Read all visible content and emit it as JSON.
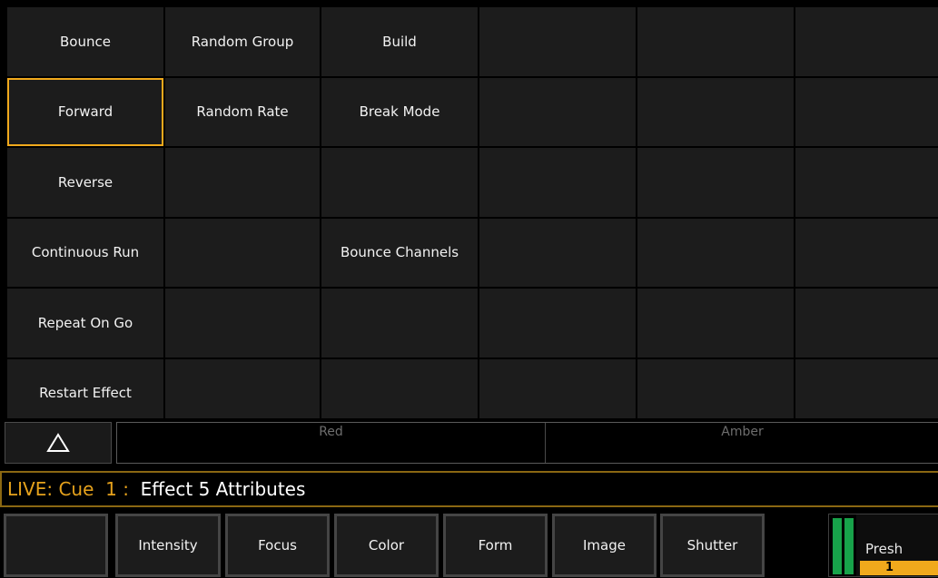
{
  "grid_cells": [
    "Bounce",
    "Random Group",
    "Build",
    "",
    "",
    "",
    "Forward",
    "Random Rate",
    "Break Mode",
    "",
    "",
    "",
    "Reverse",
    "",
    "",
    "",
    "",
    "",
    "Continuous Run",
    "",
    "Bounce Channels",
    "",
    "",
    "",
    "Repeat On Go",
    "",
    "",
    "",
    "",
    "",
    "Restart Effect",
    "",
    "",
    "",
    "",
    ""
  ],
  "selected_cell": "Forward",
  "encoders": {
    "up_icon": "triangle-up-icon",
    "labels": [
      "Red",
      "Amber"
    ]
  },
  "command_line": {
    "live": "LIVE: Cue  1 :  ",
    "description": "Effect 5 Attributes"
  },
  "softkeys": [
    "",
    "Intensity",
    "Focus",
    "Color",
    "Form",
    "Image",
    "Shutter"
  ],
  "preset": {
    "label": "Presh",
    "number": "1",
    "fader_levels": [
      1.0,
      1.0
    ]
  },
  "colors": {
    "accent": "#f0a91c",
    "fader": "#17a34a",
    "cell_bg": "#1c1c1c"
  }
}
